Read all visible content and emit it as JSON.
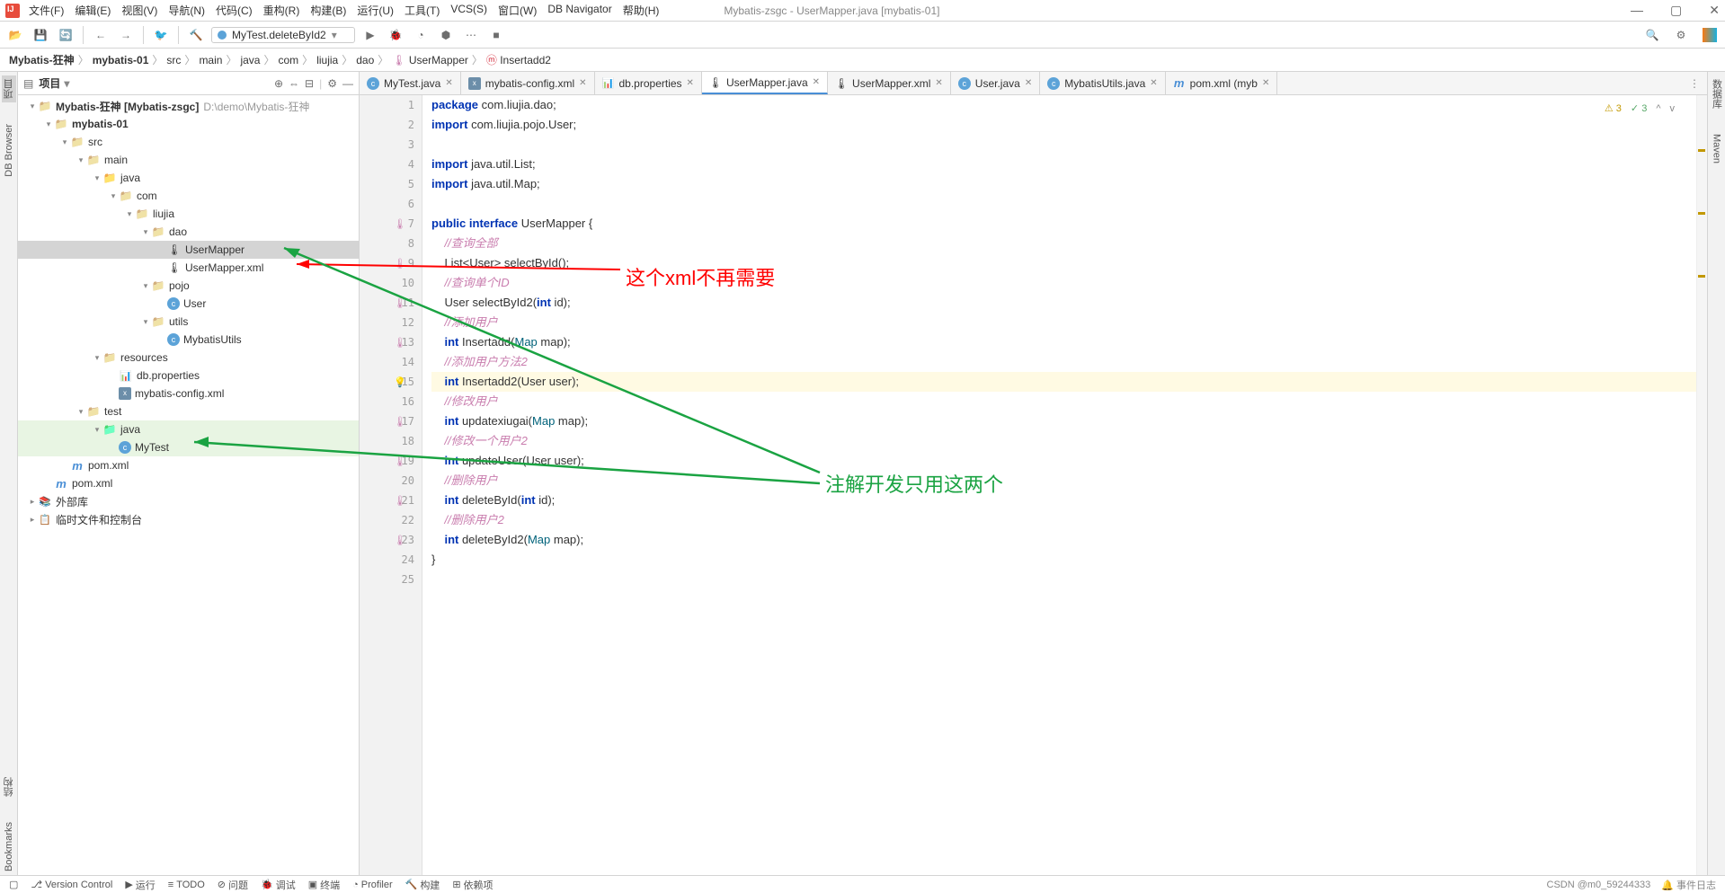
{
  "window_title": "Mybatis-zsgc - UserMapper.java [mybatis-01]",
  "menu": [
    "文件(F)",
    "编辑(E)",
    "视图(V)",
    "导航(N)",
    "代码(C)",
    "重构(R)",
    "构建(B)",
    "运行(U)",
    "工具(T)",
    "VCS(S)",
    "窗口(W)",
    "DB Navigator",
    "帮助(H)"
  ],
  "run_config": "MyTest.deleteById2",
  "breadcrumbs": [
    "Mybatis-狂神",
    "mybatis-01",
    "src",
    "main",
    "java",
    "com",
    "liujia",
    "dao",
    "UserMapper",
    "Insertadd2"
  ],
  "proj_header": "项目",
  "tree": [
    {
      "d": 0,
      "arrow": "v",
      "ic": "folder",
      "label": "Mybatis-狂神",
      "extra": "[Mybatis-zsgc]",
      "grey": "D:\\demo\\Mybatis-狂神",
      "bold": true
    },
    {
      "d": 1,
      "arrow": "v",
      "ic": "folder",
      "label": "mybatis-01",
      "bold": true
    },
    {
      "d": 2,
      "arrow": "v",
      "ic": "folder",
      "label": "src"
    },
    {
      "d": 3,
      "arrow": "v",
      "ic": "folder",
      "label": "main"
    },
    {
      "d": 4,
      "arrow": "v",
      "ic": "folder-src",
      "label": "java"
    },
    {
      "d": 5,
      "arrow": "v",
      "ic": "folder",
      "label": "com"
    },
    {
      "d": 6,
      "arrow": "v",
      "ic": "folder",
      "label": "liujia"
    },
    {
      "d": 7,
      "arrow": "v",
      "ic": "folder",
      "label": "dao"
    },
    {
      "d": 8,
      "arrow": "",
      "ic": "intf",
      "label": "UserMapper",
      "sel": true
    },
    {
      "d": 8,
      "arrow": "",
      "ic": "intf",
      "label": "UserMapper.xml"
    },
    {
      "d": 7,
      "arrow": "v",
      "ic": "folder",
      "label": "pojo"
    },
    {
      "d": 8,
      "arrow": "",
      "ic": "cls",
      "label": "User"
    },
    {
      "d": 7,
      "arrow": "v",
      "ic": "folder",
      "label": "utils"
    },
    {
      "d": 8,
      "arrow": "",
      "ic": "cls",
      "label": "MybatisUtils"
    },
    {
      "d": 4,
      "arrow": "v",
      "ic": "folder",
      "label": "resources"
    },
    {
      "d": 5,
      "arrow": "",
      "ic": "prop",
      "label": "db.properties"
    },
    {
      "d": 5,
      "arrow": "",
      "ic": "xml",
      "label": "mybatis-config.xml"
    },
    {
      "d": 3,
      "arrow": "v",
      "ic": "folder",
      "label": "test"
    },
    {
      "d": 4,
      "arrow": "v",
      "ic": "folder-test",
      "label": "java",
      "hl": "green"
    },
    {
      "d": 5,
      "arrow": "",
      "ic": "cls",
      "label": "MyTest",
      "hl": "green"
    },
    {
      "d": 2,
      "arrow": "",
      "ic": "pom",
      "label": "pom.xml"
    },
    {
      "d": 1,
      "arrow": "",
      "ic": "pom",
      "label": "pom.xml"
    },
    {
      "d": 0,
      "arrow": ">",
      "ic": "lib",
      "label": "外部库"
    },
    {
      "d": 0,
      "arrow": ">",
      "ic": "scratch",
      "label": "临时文件和控制台"
    }
  ],
  "tabs": [
    {
      "ic": "cls",
      "label": "MyTest.java"
    },
    {
      "ic": "xml",
      "label": "mybatis-config.xml"
    },
    {
      "ic": "prop",
      "label": "db.properties"
    },
    {
      "ic": "intf",
      "label": "UserMapper.java",
      "active": true
    },
    {
      "ic": "intf",
      "label": "UserMapper.xml"
    },
    {
      "ic": "cls",
      "label": "User.java"
    },
    {
      "ic": "cls",
      "label": "MybatisUtils.java"
    },
    {
      "ic": "pom",
      "label": "pom.xml (myb"
    }
  ],
  "inspection": {
    "warn": "3",
    "ok": "3"
  },
  "code": [
    {
      "n": 1,
      "html": "<span class='kw'>package</span> com.liujia.dao;"
    },
    {
      "n": 2,
      "html": "<span class='kw'>import</span> com.liujia.pojo.User;"
    },
    {
      "n": 3,
      "html": ""
    },
    {
      "n": 4,
      "html": "<span class='kw'>import</span> java.util.List;"
    },
    {
      "n": 5,
      "html": "<span class='kw'>import</span> java.util.Map;"
    },
    {
      "n": 6,
      "html": ""
    },
    {
      "n": 7,
      "html": "<span class='kw'>public</span> <span class='kw'>interface</span> UserMapper {",
      "g": "intf"
    },
    {
      "n": 8,
      "html": "    <span class='com2'>//查询全部</span>"
    },
    {
      "n": 9,
      "html": "    List&lt;User&gt; selectById();",
      "g": "intf"
    },
    {
      "n": 10,
      "html": "    <span class='com2'>//查询单个ID</span>"
    },
    {
      "n": 11,
      "html": "    User selectById2(<span class='kw'>int</span> id);",
      "g": "intf"
    },
    {
      "n": 12,
      "html": "    <span class='com2'>//添加用户</span>"
    },
    {
      "n": 13,
      "html": "    <span class='kw'>int</span> Insertadd(<span class='type'>Map</span> map);",
      "g": "intf"
    },
    {
      "n": 14,
      "html": "    <span class='com2'>//添加用户方法2</span>"
    },
    {
      "n": 15,
      "html": "    <span class='kw'>int</span> Insertadd2(User user);",
      "hl": true,
      "g": "bulb"
    },
    {
      "n": 16,
      "html": "    <span class='com2'>//修改用户</span>"
    },
    {
      "n": 17,
      "html": "    <span class='kw'>int</span> updatexiugai(<span class='type'>Map</span> map);",
      "g": "intf"
    },
    {
      "n": 18,
      "html": "    <span class='com2'>//修改一个用户2</span>"
    },
    {
      "n": 19,
      "html": "    <span class='kw'>int</span> updateUser(User user);",
      "g": "intf"
    },
    {
      "n": 20,
      "html": "    <span class='com2'>//删除用户</span>"
    },
    {
      "n": 21,
      "html": "    <span class='kw'>int</span> deleteById(<span class='kw'>int</span> id);",
      "g": "intf"
    },
    {
      "n": 22,
      "html": "    <span class='com2'>//删除用户2</span>"
    },
    {
      "n": 23,
      "html": "    <span class='kw'>int</span> deleteById2(<span class='type'>Map</span> map);",
      "g": "intf"
    },
    {
      "n": 24,
      "html": "}"
    },
    {
      "n": 25,
      "html": ""
    }
  ],
  "left_labels": [
    "项目",
    "DB Browser",
    "结构",
    "Bookmarks"
  ],
  "right_labels": [
    "数据库",
    "Maven"
  ],
  "bottom": [
    "Version Control",
    "运行",
    "TODO",
    "问题",
    "调试",
    "终端",
    "Profiler",
    "构建",
    "依赖项"
  ],
  "bottom_right": [
    "CSDN @m0_59244333",
    "事件日志"
  ],
  "anno_red": "这个xml不再需要",
  "anno_green": "注解开发只用这两个"
}
